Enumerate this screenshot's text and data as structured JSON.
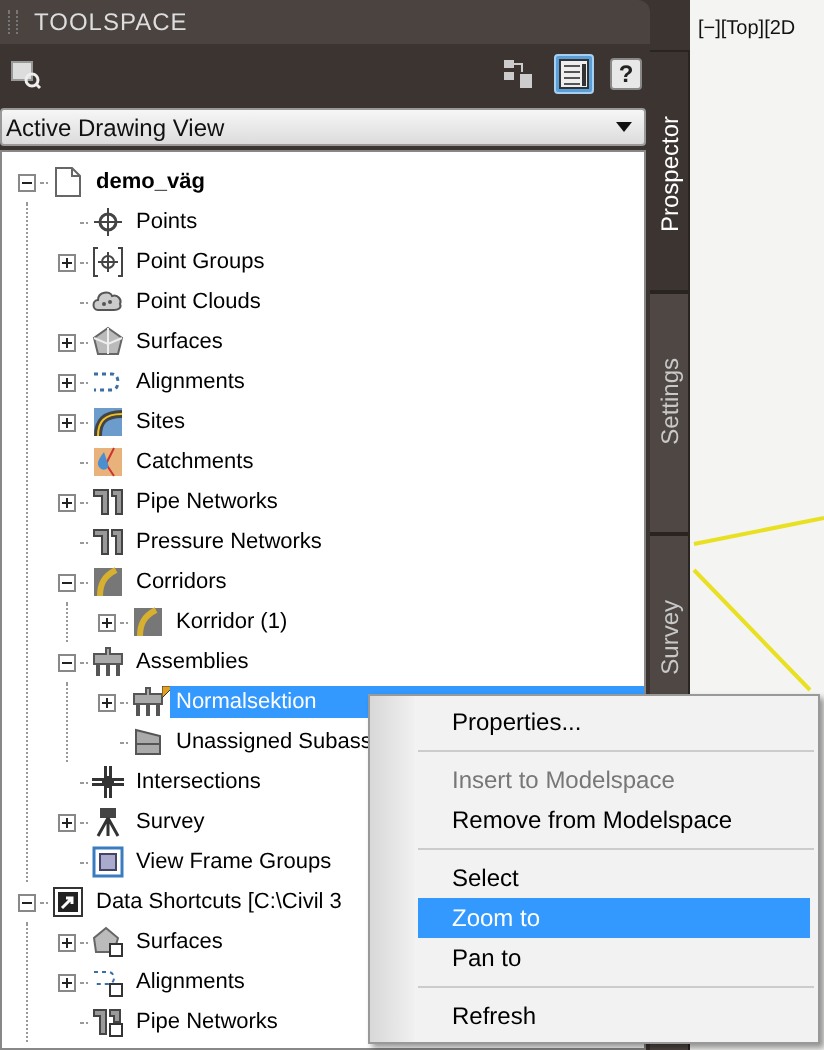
{
  "palette": {
    "title": "TOOLSPACE"
  },
  "toolbar": {
    "tools": [
      {
        "kind": "find",
        "selected": false
      },
      {
        "kind": "tree",
        "selected": false
      },
      {
        "kind": "grid",
        "selected": true
      },
      {
        "kind": "help",
        "label": "?",
        "selected": false
      }
    ]
  },
  "view_select": {
    "value": "Active Drawing View"
  },
  "tree": [
    {
      "label": "demo_väg",
      "kind": "drawing",
      "bold": true,
      "expanded": true,
      "selected": false,
      "children": [
        {
          "label": "Points",
          "kind": "point",
          "selected": false
        },
        {
          "label": "Point Groups",
          "kind": "group",
          "expanded": false,
          "selected": false
        },
        {
          "label": "Point Clouds",
          "kind": "cloud",
          "selected": false
        },
        {
          "label": "Surfaces",
          "kind": "surface",
          "expanded": false,
          "selected": false
        },
        {
          "label": "Alignments",
          "kind": "alignment",
          "expanded": false,
          "selected": false
        },
        {
          "label": "Sites",
          "kind": "site",
          "expanded": false,
          "selected": false
        },
        {
          "label": "Catchments",
          "kind": "catchment",
          "selected": false
        },
        {
          "label": "Pipe Networks",
          "kind": "pipe",
          "expanded": false,
          "selected": false
        },
        {
          "label": "Pressure Networks",
          "kind": "pipe",
          "selected": false
        },
        {
          "label": "Corridors",
          "kind": "corridor",
          "expanded": true,
          "selected": false,
          "children": [
            {
              "label": "Korridor (1)",
              "kind": "corridor",
              "expanded": false,
              "selected": false
            }
          ]
        },
        {
          "label": "Assemblies",
          "kind": "assembly",
          "expanded": true,
          "selected": false,
          "children": [
            {
              "label": "Normalsektion",
              "kind": "assembly",
              "expanded": false,
              "flagged": true,
              "selected": true
            },
            {
              "label": "Unassigned Subass",
              "kind": "subassembly",
              "selected": false
            }
          ]
        },
        {
          "label": "Intersections",
          "kind": "intersection",
          "selected": false
        },
        {
          "label": "Survey",
          "kind": "survey",
          "expanded": false,
          "selected": false
        },
        {
          "label": "View Frame Groups",
          "kind": "frame",
          "selected": false
        }
      ]
    },
    {
      "label": "Data Shortcuts [C:\\Civil 3",
      "kind": "shortcut",
      "bold": false,
      "expanded": true,
      "selected": false,
      "children": [
        {
          "label": "Surfaces",
          "kind": "surfaceref",
          "expanded": false,
          "selected": false
        },
        {
          "label": "Alignments",
          "kind": "alignmentref",
          "expanded": false,
          "selected": false
        },
        {
          "label": "Pipe Networks",
          "kind": "piperef",
          "selected": false
        }
      ]
    }
  ],
  "side_tabs": [
    {
      "label": "Prospector",
      "selected": true
    },
    {
      "label": "Settings",
      "selected": false
    },
    {
      "label": "Survey",
      "selected": false
    }
  ],
  "viewport": {
    "label": "[−][Top][2D"
  },
  "context_menu": [
    {
      "kind": "item",
      "label": "Properties...",
      "disabled": false,
      "selected": false
    },
    {
      "kind": "separator"
    },
    {
      "kind": "item",
      "label": "Insert to Modelspace",
      "disabled": true,
      "selected": false
    },
    {
      "kind": "item",
      "label": "Remove from Modelspace",
      "disabled": false,
      "selected": false
    },
    {
      "kind": "separator"
    },
    {
      "kind": "item",
      "label": "Select",
      "disabled": false,
      "selected": false
    },
    {
      "kind": "item",
      "label": "Zoom to",
      "disabled": false,
      "selected": true
    },
    {
      "kind": "item",
      "label": "Pan to",
      "disabled": false,
      "selected": false
    },
    {
      "kind": "separator"
    },
    {
      "kind": "item",
      "label": "Refresh",
      "disabled": false,
      "selected": false
    }
  ]
}
